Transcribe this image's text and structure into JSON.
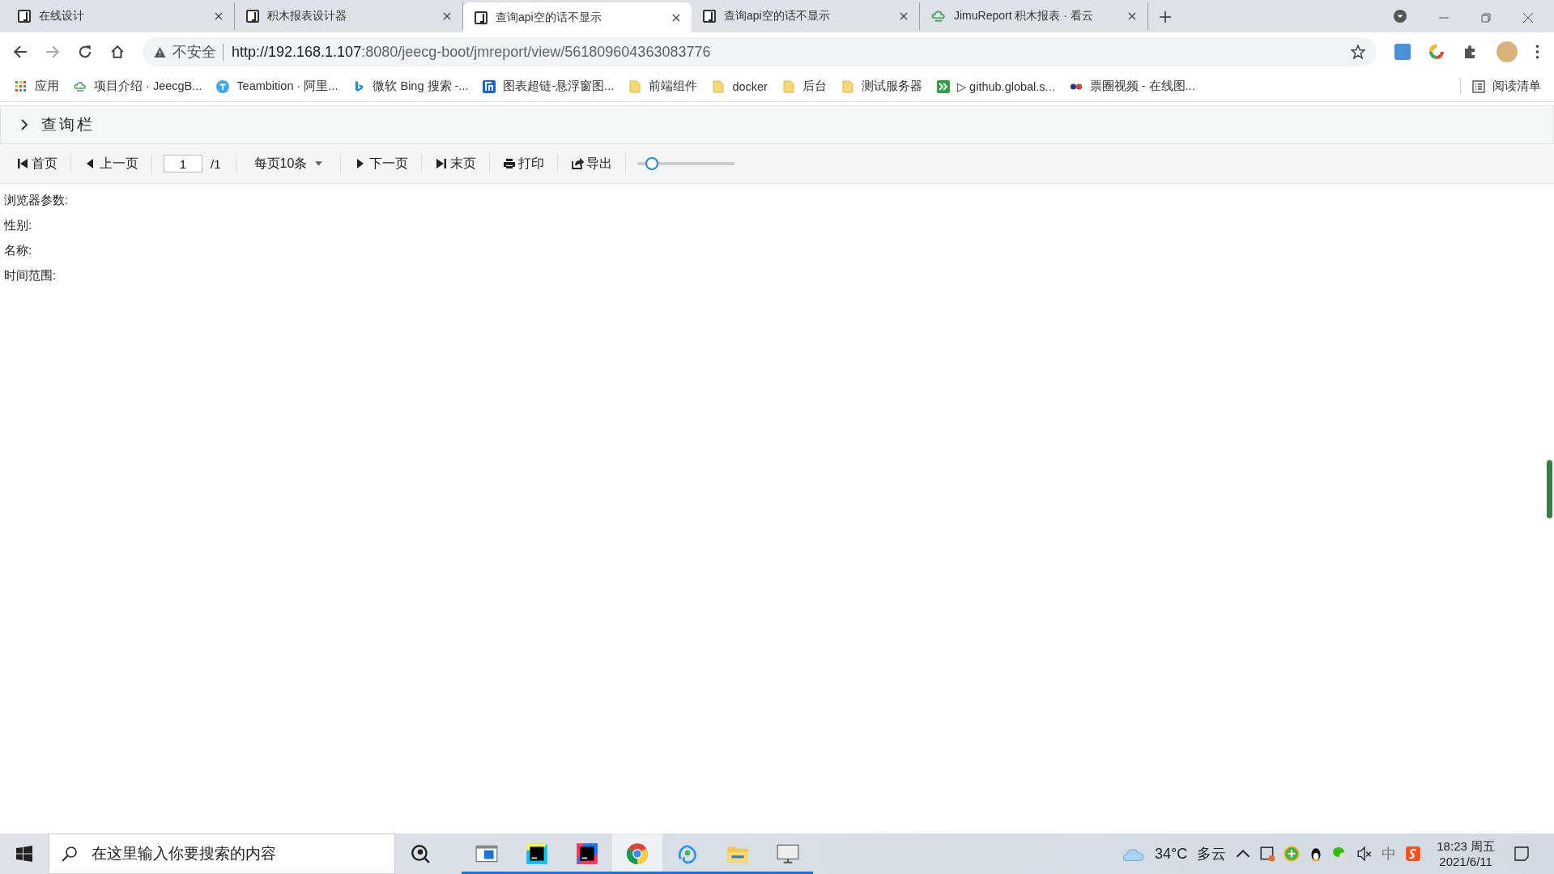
{
  "tabs": [
    {
      "title": "在线设计",
      "kind": "j",
      "selected": false
    },
    {
      "title": "积木报表设计器",
      "kind": "j",
      "selected": false
    },
    {
      "title": "查询api空的话不显示",
      "kind": "j",
      "selected": true
    },
    {
      "title": "查询api空的话不显示",
      "kind": "j",
      "selected": false
    },
    {
      "title": "JimuReport 积木报表 · 看云",
      "kind": "cloud",
      "selected": false
    }
  ],
  "address": {
    "security": "不安全",
    "url_host": "http://192.168.1.107",
    "url_rest": ":8080/jeecg-boot/jmreport/view/561809604363083776"
  },
  "bookmarks": [
    {
      "label": "应用",
      "kind": "apps"
    },
    {
      "label": "项目介绍 · JeecgB...",
      "kind": "cloud"
    },
    {
      "label": "Teambition · 阿里...",
      "kind": "tb"
    },
    {
      "label": "微软 Bing 搜索 -...",
      "kind": "bing"
    },
    {
      "label": "图表超链-悬浮窗图...",
      "kind": "chart"
    },
    {
      "label": "前端组件",
      "kind": "folder"
    },
    {
      "label": "docker",
      "kind": "folder"
    },
    {
      "label": "后台",
      "kind": "folder"
    },
    {
      "label": "测试服务器",
      "kind": "folder"
    },
    {
      "label": "▷ github.global.s...",
      "kind": "green"
    },
    {
      "label": "票圈视频 - 在线图...",
      "kind": "glasses"
    }
  ],
  "reading_list": "阅读清单",
  "query_bar": {
    "title": "查询栏",
    "expanded": false
  },
  "toolbar": [
    {
      "kind": "first",
      "label": "首页"
    },
    {
      "kind": "prev",
      "label": "上一页"
    },
    {
      "kind": "page",
      "value": "1",
      "total": "/1"
    },
    {
      "kind": "select",
      "label": "每页10条"
    },
    {
      "kind": "next",
      "label": "下一页"
    },
    {
      "kind": "last",
      "label": "末页"
    },
    {
      "kind": "print",
      "label": "打印"
    },
    {
      "kind": "export",
      "label": "导出"
    },
    {
      "kind": "slider",
      "level": 0.15
    }
  ],
  "params": [
    "浏览器参数:",
    "性别:",
    "名称:",
    "时间范围:"
  ],
  "taskbar": {
    "search_placeholder": "在这里输入你要搜索的内容",
    "apps": [
      {
        "kind": "window",
        "running": true,
        "selected": false
      },
      {
        "kind": "ws",
        "running": true,
        "selected": false
      },
      {
        "kind": "ij",
        "running": true,
        "selected": false
      },
      {
        "kind": "chrome",
        "running": true,
        "selected": true
      },
      {
        "kind": "navicat",
        "running": true,
        "selected": false
      },
      {
        "kind": "explorer",
        "running": true,
        "selected": false
      },
      {
        "kind": "monitor",
        "running": true,
        "selected": false
      }
    ],
    "temperature": "34°C",
    "weather": "多云",
    "ime": "中",
    "time": "18:23 周五",
    "date": "2021/6/11"
  }
}
